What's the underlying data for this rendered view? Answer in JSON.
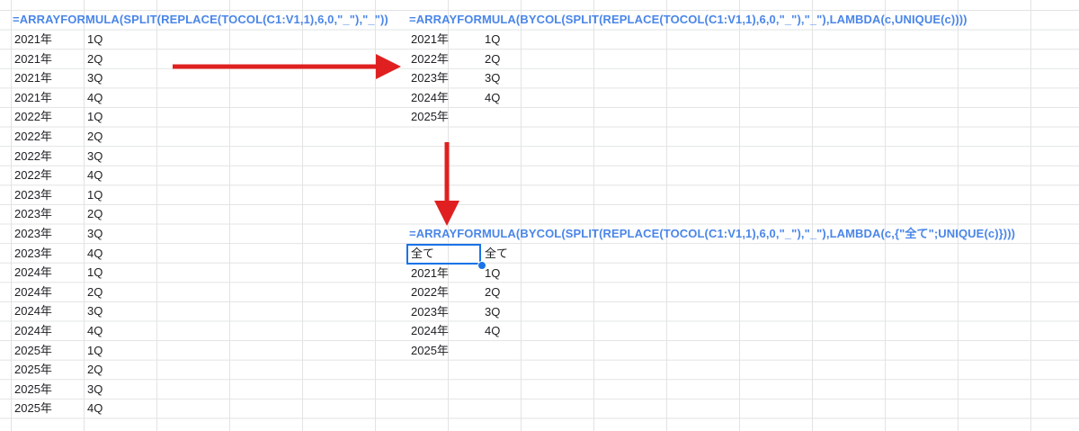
{
  "colors": {
    "formula": "#4a86e8",
    "arrow": "#e02020",
    "selection": "#1a73e8",
    "gridline": "#e2e3e3"
  },
  "left_block": {
    "formula": "=ARRAYFORMULA(SPLIT(REPLACE(TOCOL(C1:V1,1),6,0,\"_\"),\"_\"))",
    "rows": [
      [
        "2021年",
        "1Q"
      ],
      [
        "2021年",
        "2Q"
      ],
      [
        "2021年",
        "3Q"
      ],
      [
        "2021年",
        "4Q"
      ],
      [
        "2022年",
        "1Q"
      ],
      [
        "2022年",
        "2Q"
      ],
      [
        "2022年",
        "3Q"
      ],
      [
        "2022年",
        "4Q"
      ],
      [
        "2023年",
        "1Q"
      ],
      [
        "2023年",
        "2Q"
      ],
      [
        "2023年",
        "3Q"
      ],
      [
        "2023年",
        "4Q"
      ],
      [
        "2024年",
        "1Q"
      ],
      [
        "2024年",
        "2Q"
      ],
      [
        "2024年",
        "3Q"
      ],
      [
        "2024年",
        "4Q"
      ],
      [
        "2025年",
        "1Q"
      ],
      [
        "2025年",
        "2Q"
      ],
      [
        "2025年",
        "3Q"
      ],
      [
        "2025年",
        "4Q"
      ]
    ]
  },
  "top_right_block": {
    "formula": "=ARRAYFORMULA(BYCOL(SPLIT(REPLACE(TOCOL(C1:V1,1),6,0,\"_\"),\"_\"),LAMBDA(c,UNIQUE(c))))",
    "rows": [
      [
        "2021年",
        "1Q"
      ],
      [
        "2022年",
        "2Q"
      ],
      [
        "2023年",
        "3Q"
      ],
      [
        "2024年",
        "4Q"
      ],
      [
        "2025年",
        ""
      ]
    ]
  },
  "bottom_right_block": {
    "formula": "=ARRAYFORMULA(BYCOL(SPLIT(REPLACE(TOCOL(C1:V1,1),6,0,\"_\"),\"_\"),LAMBDA(c,{\"全て\";UNIQUE(c)})))",
    "rows": [
      [
        "全て",
        "全て"
      ],
      [
        "2021年",
        "1Q"
      ],
      [
        "2022年",
        "2Q"
      ],
      [
        "2023年",
        "3Q"
      ],
      [
        "2024年",
        "4Q"
      ],
      [
        "2025年",
        ""
      ]
    ]
  }
}
